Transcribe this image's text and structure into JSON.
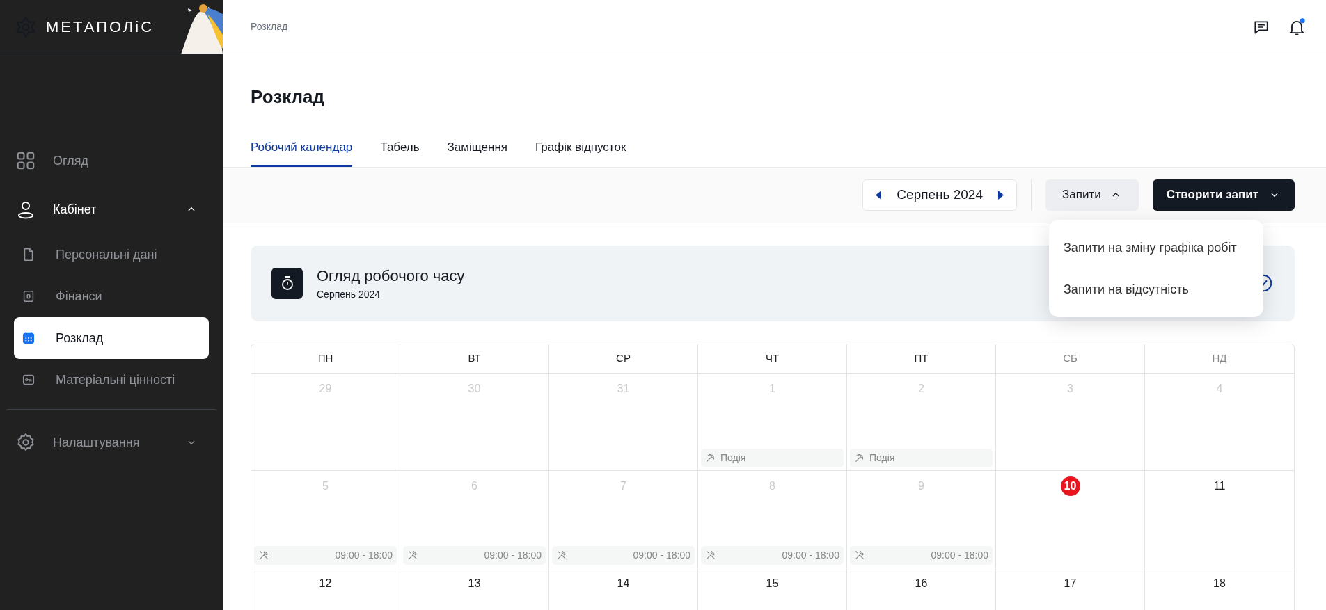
{
  "sidebar": {
    "logo": "МЕТАПОЛіС",
    "items": [
      {
        "kind": "item",
        "label": "Огляд",
        "selected": false
      },
      {
        "kind": "group",
        "label": "Кабінет",
        "selected": false,
        "expanded": true,
        "children": [
          {
            "label": "Персональні дані",
            "selected": false
          },
          {
            "label": "Фінанси",
            "selected": false
          },
          {
            "label": "Розклад",
            "selected": true
          },
          {
            "label": "Матеріальні цінності",
            "selected": false
          }
        ]
      },
      {
        "kind": "divider"
      },
      {
        "kind": "group",
        "label": "Налаштування",
        "selected": false,
        "expanded": false
      }
    ]
  },
  "header": {
    "breadcrumb": "Розклад",
    "notifications_unread": true
  },
  "page": {
    "title": "Розклад"
  },
  "tabs": [
    {
      "label": "Робочий календар",
      "selected": true
    },
    {
      "label": "Табель",
      "selected": false
    },
    {
      "label": "Заміщення",
      "selected": false
    },
    {
      "label": "Графік відпусток",
      "selected": false
    }
  ],
  "toolbar": {
    "month": "Серпень 2024",
    "requests_button": {
      "label": "Запити",
      "expanded": true
    },
    "create_button": {
      "label": "Створити запит",
      "expanded": false
    }
  },
  "requests_menu": [
    "Запити на зміну графіка робіт",
    "Запити на відсутність"
  ],
  "overview_card": {
    "title": "Огляд робочого часу",
    "subtitle": "Серпень 2024"
  },
  "calendar": {
    "weekdays": [
      {
        "label": "ПН",
        "weekend": false
      },
      {
        "label": "ВТ",
        "weekend": false
      },
      {
        "label": "СР",
        "weekend": false
      },
      {
        "label": "ЧТ",
        "weekend": false
      },
      {
        "label": "ПТ",
        "weekend": false
      },
      {
        "label": "СБ",
        "weekend": true
      },
      {
        "label": "НД",
        "weekend": true
      }
    ],
    "weeks": [
      [
        {
          "day": "29",
          "muted": true,
          "today": false
        },
        {
          "day": "30",
          "muted": true,
          "today": false
        },
        {
          "day": "31",
          "muted": true,
          "today": false
        },
        {
          "day": "1",
          "muted": true,
          "today": false,
          "events": [
            {
              "kind": "event",
              "label": "Подія"
            }
          ]
        },
        {
          "day": "2",
          "muted": true,
          "today": false,
          "events": [
            {
              "kind": "event",
              "label": "Подія"
            }
          ]
        },
        {
          "day": "3",
          "muted": true,
          "today": false
        },
        {
          "day": "4",
          "muted": true,
          "today": false
        }
      ],
      [
        {
          "day": "5",
          "muted": true,
          "today": false,
          "events": [
            {
              "kind": "shift",
              "label": "09:00 - 18:00"
            }
          ]
        },
        {
          "day": "6",
          "muted": true,
          "today": false,
          "events": [
            {
              "kind": "shift",
              "label": "09:00 - 18:00"
            }
          ]
        },
        {
          "day": "7",
          "muted": true,
          "today": false,
          "events": [
            {
              "kind": "shift",
              "label": "09:00 - 18:00"
            }
          ]
        },
        {
          "day": "8",
          "muted": true,
          "today": false,
          "events": [
            {
              "kind": "shift",
              "label": "09:00 - 18:00"
            }
          ]
        },
        {
          "day": "9",
          "muted": true,
          "today": false,
          "events": [
            {
              "kind": "shift",
              "label": "09:00 - 18:00"
            }
          ]
        },
        {
          "day": "10",
          "muted": false,
          "today": true
        },
        {
          "day": "11",
          "muted": false,
          "today": false
        }
      ],
      [
        {
          "day": "12",
          "muted": false,
          "today": false
        },
        {
          "day": "13",
          "muted": false,
          "today": false
        },
        {
          "day": "14",
          "muted": false,
          "today": false
        },
        {
          "day": "15",
          "muted": false,
          "today": false
        },
        {
          "day": "16",
          "muted": false,
          "today": false
        },
        {
          "day": "17",
          "muted": false,
          "today": false
        },
        {
          "day": "18",
          "muted": false,
          "today": false
        }
      ]
    ]
  }
}
